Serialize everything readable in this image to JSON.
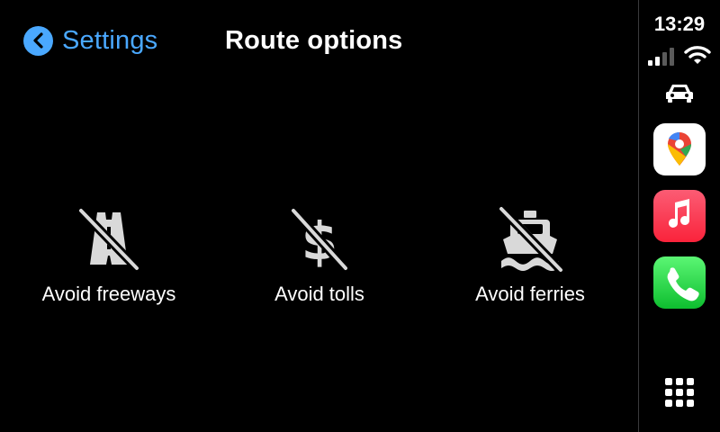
{
  "header": {
    "back_label": "Settings",
    "title": "Route options"
  },
  "options": [
    {
      "label": "Avoid freeways",
      "icon": "freeway-crossed-icon"
    },
    {
      "label": "Avoid tolls",
      "icon": "dollar-crossed-icon"
    },
    {
      "label": "Avoid ferries",
      "icon": "ferry-crossed-icon"
    }
  ],
  "status_bar": {
    "time": "13:29",
    "signal_bars": 2,
    "signal_total": 4
  },
  "dock": {
    "apps": [
      "maps-app-icon",
      "music-app-icon",
      "phone-app-icon"
    ],
    "home_icon": "app-grid-icon"
  },
  "colors": {
    "accent": "#4aa8ff",
    "background": "#000000",
    "icon_gray": "#d9d9d9"
  }
}
